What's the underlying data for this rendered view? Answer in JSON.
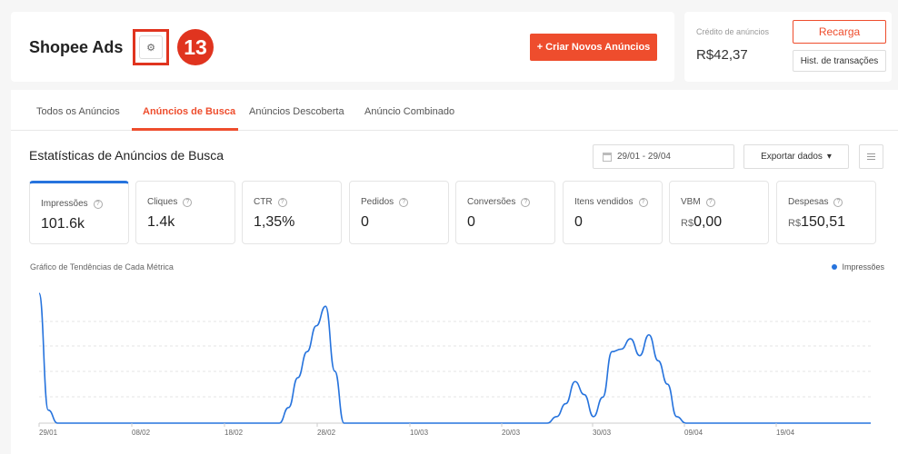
{
  "header": {
    "title": "Shopee Ads",
    "step_number": "13",
    "create_button": "+ Criar Novos Anúncios"
  },
  "credit": {
    "label": "Crédito de anúncios",
    "value": "R$42,37",
    "recharge_button": "Recarga",
    "history_button": "Hist. de transações"
  },
  "tabs": [
    {
      "label": "Todos os Anúncios",
      "active": false
    },
    {
      "label": "Anúncios de Busca",
      "active": true
    },
    {
      "label": "Anúncios Descoberta",
      "active": false
    },
    {
      "label": "Anúncio Combinado",
      "active": false
    }
  ],
  "stats": {
    "title": "Estatísticas de Anúncios de Busca",
    "date_range": "29/01 - 29/04",
    "export_button": "Exportar dados"
  },
  "metrics": [
    {
      "label": "Impressões",
      "value": "101.6k",
      "prefix": "",
      "active": true
    },
    {
      "label": "Cliques",
      "value": "1.4k",
      "prefix": "",
      "active": false
    },
    {
      "label": "CTR",
      "value": "1,35%",
      "prefix": "",
      "active": false
    },
    {
      "label": "Pedidos",
      "value": "0",
      "prefix": "",
      "active": false
    },
    {
      "label": "Conversões",
      "value": "0",
      "prefix": "",
      "active": false
    },
    {
      "label": "Itens vendidos",
      "value": "0",
      "prefix": "",
      "active": false
    },
    {
      "label": "VBM",
      "value": "0,00",
      "prefix": "R$",
      "active": false
    },
    {
      "label": "Despesas",
      "value": "150,51",
      "prefix": "R$",
      "active": false
    }
  ],
  "chart_title": "Gráfico de Tendências de Cada Métrica",
  "colors": {
    "accent": "#ee4d2d",
    "line": "#2673dd",
    "badge": "#e0341f"
  },
  "chart_data": {
    "type": "line",
    "x_ticks": [
      "29/01",
      "08/02",
      "18/02",
      "28/02",
      "10/03",
      "20/03",
      "30/03",
      "09/04",
      "19/04"
    ],
    "series": [
      {
        "name": "Impressões",
        "x": [
          0,
          1,
          2,
          3,
          4,
          5,
          6,
          7,
          8,
          9,
          10,
          11,
          12,
          13,
          14,
          15,
          16,
          17,
          18,
          19,
          20,
          21,
          22,
          23,
          24,
          25,
          26,
          27,
          28,
          29,
          30,
          31,
          32,
          33,
          34,
          35,
          36,
          37,
          38,
          39,
          40,
          41,
          42,
          43,
          44,
          45,
          46,
          47,
          48,
          49,
          50,
          51,
          52,
          53,
          54,
          55,
          56,
          57,
          58,
          59,
          60,
          61,
          62,
          63,
          64,
          65,
          66,
          67,
          68,
          69,
          70,
          71,
          72,
          73,
          74,
          75,
          76,
          77,
          78,
          79,
          80,
          81,
          82,
          83,
          84,
          85,
          86,
          87,
          88,
          89,
          90
        ],
        "values": [
          1.0,
          0.1,
          0,
          0,
          0,
          0,
          0,
          0,
          0,
          0,
          0,
          0,
          0,
          0,
          0,
          0,
          0,
          0,
          0,
          0,
          0,
          0,
          0,
          0,
          0,
          0,
          0,
          0.12,
          0.35,
          0.55,
          0.75,
          0.9,
          0.4,
          0,
          0,
          0,
          0,
          0,
          0,
          0,
          0,
          0,
          0,
          0,
          0,
          0,
          0,
          0,
          0,
          0,
          0,
          0,
          0,
          0,
          0,
          0,
          0.05,
          0.15,
          0.32,
          0.22,
          0.05,
          0.2,
          0.55,
          0.57,
          0.65,
          0.52,
          0.68,
          0.48,
          0.3,
          0.05,
          0,
          0,
          0,
          0,
          0,
          0,
          0,
          0,
          0,
          0,
          0,
          0,
          0,
          0,
          0,
          0,
          0,
          0,
          0,
          0,
          0
        ]
      }
    ]
  }
}
